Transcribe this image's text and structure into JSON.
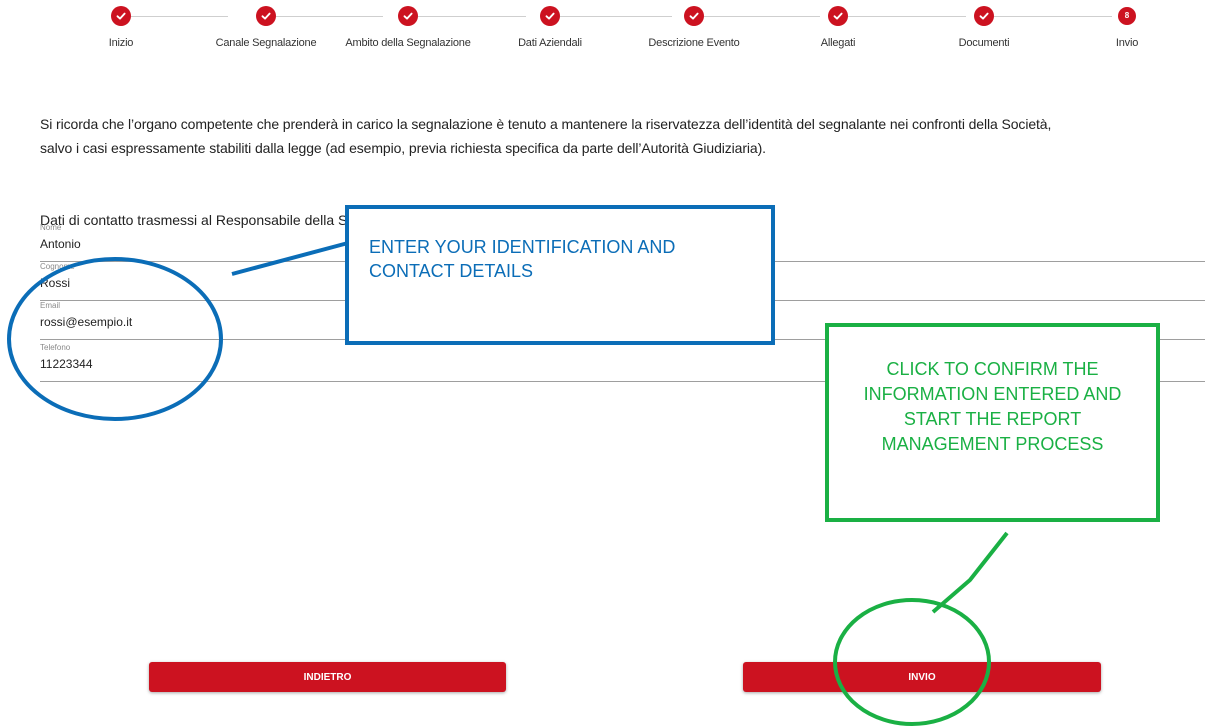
{
  "stepper": {
    "steps": [
      {
        "label": "Inizio",
        "status": "done"
      },
      {
        "label": "Canale Segnalazione",
        "status": "done"
      },
      {
        "label": "Ambito della Segnalazione",
        "status": "done"
      },
      {
        "label": "Dati Aziendali",
        "status": "done"
      },
      {
        "label": "Descrizione Evento",
        "status": "done"
      },
      {
        "label": "Allegati",
        "status": "done"
      },
      {
        "label": "Documenti",
        "status": "done"
      },
      {
        "label": "Invio",
        "status": "current",
        "number": "8"
      }
    ],
    "done_icon": "check-icon",
    "accent_color": "#cc1220"
  },
  "notice": {
    "line1": "Si ricorda che l’organo competente che prenderà in carico la segnalazione è tenuto a mantenere la riservatezza dell’identità del segnalante nei confronti della Società,",
    "line2": "salvo i casi espressamente stabiliti dalla legge (ad esempio, previa richiesta specifica da parte dell’Autorità Giudiziaria)."
  },
  "contact": {
    "title": "Dati di contatto trasmessi al Responsabile della Segnalazione",
    "fields": {
      "nome": {
        "label": "Nome",
        "value": "Antonio"
      },
      "cognome": {
        "label": "Cognome",
        "value": "Rossi"
      },
      "email": {
        "label": "Email",
        "value": "rossi@esempio.it"
      },
      "telefono": {
        "label": "Telefono",
        "value": "11223344"
      }
    }
  },
  "actions": {
    "back_label": "INDIETRO",
    "submit_label": "INVIO",
    "button_color": "#cc1220"
  },
  "annotations": {
    "blue_text": "ENTER YOUR IDENTIFICATION AND CONTACT DETAILS",
    "green_text": "CLICK TO CONFIRM THE INFORMATION ENTERED AND START THE REPORT MANAGEMENT PROCESS",
    "blue_color": "#0b6db7",
    "green_color": "#1ab044"
  }
}
